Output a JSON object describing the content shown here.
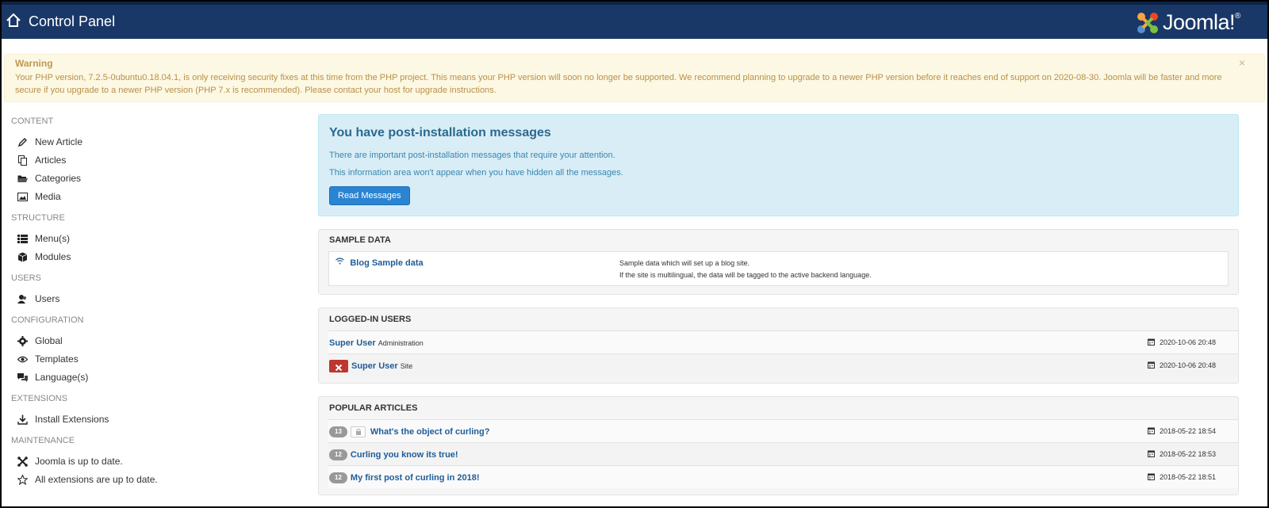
{
  "header": {
    "title": "Control Panel",
    "logo_text": "Joomla!",
    "logo_reg": "®"
  },
  "warning": {
    "title": "Warning",
    "text": "Your PHP version, 7.2.5-0ubuntu0.18.04.1, is only receiving security fixes at this time from the PHP project. This means your PHP version will soon no longer be supported. We recommend planning to upgrade to a newer PHP version before it reaches end of support on 2020-08-30. Joomla will be faster and more secure if you upgrade to a newer PHP version (PHP 7.x is recommended). Please contact your host for upgrade instructions.",
    "close": "×"
  },
  "sidebar": {
    "content": {
      "title": "CONTENT",
      "items": [
        "New Article",
        "Articles",
        "Categories",
        "Media"
      ]
    },
    "structure": {
      "title": "STRUCTURE",
      "items": [
        "Menu(s)",
        "Modules"
      ]
    },
    "users": {
      "title": "USERS",
      "items": [
        "Users"
      ]
    },
    "configuration": {
      "title": "CONFIGURATION",
      "items": [
        "Global",
        "Templates",
        "Language(s)"
      ]
    },
    "extensions": {
      "title": "EXTENSIONS",
      "items": [
        "Install Extensions"
      ]
    },
    "maintenance": {
      "title": "MAINTENANCE",
      "items": [
        "Joomla is up to date.",
        "All extensions are up to date."
      ]
    }
  },
  "postinstall": {
    "title": "You have post-installation messages",
    "line1": "There are important post-installation messages that require your attention.",
    "line2": "This information area won't appear when you have hidden all the messages.",
    "button": "Read Messages"
  },
  "sample_data": {
    "title": "SAMPLE DATA",
    "item_label": "Blog Sample data",
    "desc1": "Sample data which will set up a blog site.",
    "desc2": "If the site is multilingual, the data will be tagged to the active backend language."
  },
  "logged_in": {
    "title": "LOGGED-IN USERS",
    "rows": [
      {
        "name": "Super User",
        "context": "Administration",
        "date": "2020-10-06 20:48"
      },
      {
        "name": "Super User",
        "context": "Site",
        "date": "2020-10-06 20:48"
      }
    ]
  },
  "popular": {
    "title": "POPULAR ARTICLES",
    "rows": [
      {
        "hits": "13",
        "title": "What's the object of curling?",
        "date": "2018-05-22 18:54"
      },
      {
        "hits": "12",
        "title": "Curling you know its true!",
        "date": "2018-05-22 18:53"
      },
      {
        "hits": "12",
        "title": "My first post of curling in 2018!",
        "date": "2018-05-22 18:51"
      }
    ]
  },
  "colors": {
    "header_bg": "#1a3867",
    "warning_bg": "#fcf8e3",
    "info_bg": "#d9edf7",
    "primary_button": "#2a84d2",
    "danger": "#bd362f"
  }
}
